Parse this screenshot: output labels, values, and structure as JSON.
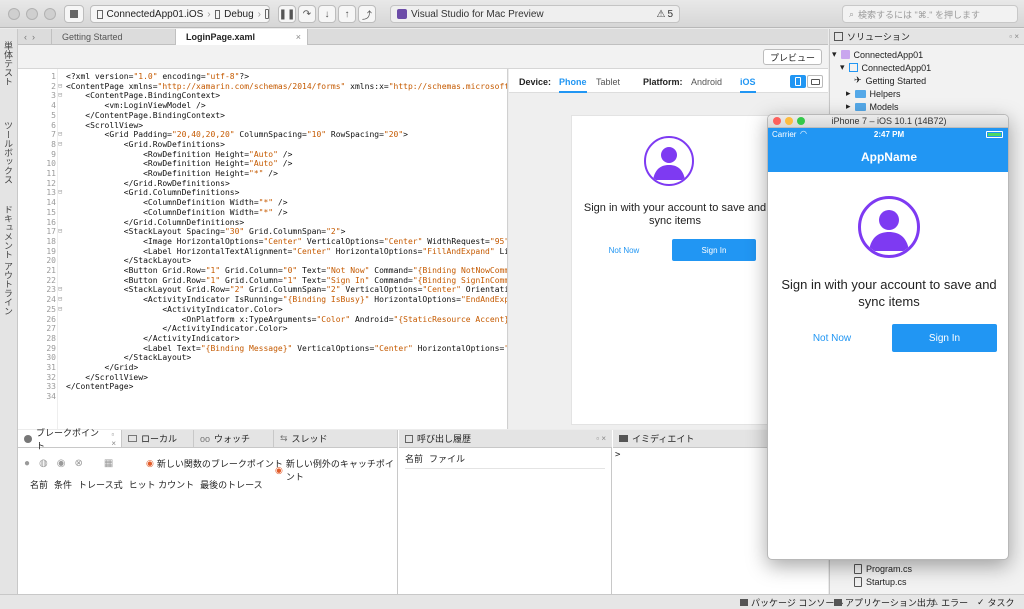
{
  "window": {
    "path_project": "ConnectedApp01.iOS",
    "path_config": "Debug",
    "status_text": "Visual Studio for Mac Preview",
    "warning_count": "5",
    "search_placeholder": "検索するには \"⌘.\" を押します"
  },
  "left_strip": {
    "items": [
      "単体テスト",
      "ツールボックス",
      "ドキュメント アウトライン"
    ]
  },
  "tabs": [
    {
      "label": "Getting Started"
    },
    {
      "label": "LoginPage.xaml"
    }
  ],
  "editor_toolbar": {
    "preview_button": "プレビュー"
  },
  "code": {
    "line_numbers": [
      "1",
      "2",
      "3",
      "4",
      "5",
      "6",
      "7",
      "8",
      "9",
      "10",
      "11",
      "12",
      "13",
      "14",
      "15",
      "16",
      "17",
      "18",
      "19",
      "20",
      "21",
      "22",
      "23",
      "24",
      "25",
      "26",
      "27",
      "28",
      "29",
      "30",
      "31",
      "32",
      "33",
      "34"
    ],
    "lines": [
      "<?xml version=\"1.0\" encoding=\"utf-8\"?>",
      "<ContentPage xmlns=\"http://xamarin.com/schemas/2014/forms\" xmlns:x=\"http://schemas.microsoft.",
      "    <ContentPage.BindingContext>",
      "        <vm:LoginViewModel />",
      "    </ContentPage.BindingContext>",
      "    <ScrollView>",
      "        <Grid Padding=\"20,40,20,20\" ColumnSpacing=\"10\" RowSpacing=\"20\">",
      "            <Grid.RowDefinitions>",
      "                <RowDefinition Height=\"Auto\" />",
      "                <RowDefinition Height=\"Auto\" />",
      "                <RowDefinition Height=\"*\" />",
      "            </Grid.RowDefinitions>",
      "            <Grid.ColumnDefinitions>",
      "                <ColumnDefinition Width=\"*\" />",
      "                <ColumnDefinition Width=\"*\" />",
      "            </Grid.ColumnDefinitions>",
      "            <StackLayout Spacing=\"30\" Grid.ColumnSpan=\"2\">",
      "                <Image HorizontalOptions=\"Center\" VerticalOptions=\"Center\" WidthRequest=\"95\"",
      "                <Label HorizontalTextAlignment=\"Center\" HorizontalOptions=\"FillAndExpand\" Lin",
      "            </StackLayout>",
      "            <Button Grid.Row=\"1\" Grid.Column=\"0\" Text=\"Not Now\" Command=\"{Binding NotNowComma",
      "            <Button Grid.Row=\"1\" Grid.Column=\"1\" Text=\"Sign In\" Command=\"{Binding SignInComma",
      "            <StackLayout Grid.Row=\"2\" Grid.ColumnSpan=\"2\" VerticalOptions=\"Center\" Orientatio",
      "                <ActivityIndicator IsRunning=\"{Binding IsBusy}\" HorizontalOptions=\"EndAndExpa",
      "                    <ActivityIndicator.Color>",
      "                        <OnPlatform x:TypeArguments=\"Color\" Android=\"{StaticResource Accent}\"",
      "                    </ActivityIndicator.Color>",
      "                </ActivityIndicator>",
      "                <Label Text=\"{Binding Message}\" VerticalOptions=\"Center\" HorizontalOptions=\"",
      "            </StackLayout>",
      "        </Grid>",
      "    </ScrollView>",
      "</ContentPage>",
      ""
    ]
  },
  "preview": {
    "device_label": "Device:",
    "device_options": [
      "Phone",
      "Tablet"
    ],
    "platform_label": "Platform:",
    "platform_options": [
      "Android",
      "iOS"
    ],
    "message": "Sign in with your account to save and sync items",
    "not_now": "Not Now",
    "sign_in": "Sign In"
  },
  "simulator": {
    "title": "iPhone 7 – iOS 10.1 (14B72)",
    "carrier": "Carrier",
    "time": "2:47 PM",
    "app_name": "AppName",
    "message": "Sign in with your account to save and sync items",
    "not_now": "Not Now",
    "sign_in": "Sign In"
  },
  "bottom": {
    "tabs": [
      {
        "label": "ブレークポイント"
      },
      {
        "label": "ローカル"
      },
      {
        "label": "ウォッチ"
      },
      {
        "label": "スレッド"
      }
    ],
    "new_function_breakpoint": "新しい関数のブレークポイント",
    "new_exception_catchpoint": "新しい例外のキャッチポイント",
    "bp_columns": [
      "名前",
      "条件",
      "トレース式",
      "ヒット カウント",
      "最後のトレース"
    ],
    "callstack_title": "呼び出し履歴",
    "callstack_columns": [
      "名前",
      "ファイル"
    ],
    "immediate_title": "イミディエイト",
    "immediate_prompt": ">"
  },
  "solution": {
    "title": "ソリューション",
    "items": [
      {
        "label": "ConnectedApp01"
      },
      {
        "label": "ConnectedApp01"
      },
      {
        "label": "Getting Started"
      },
      {
        "label": "Helpers"
      },
      {
        "label": "Models"
      }
    ],
    "bottom_items": [
      {
        "label": "Program.cs"
      },
      {
        "label": "Startup.cs"
      }
    ]
  },
  "statusbar": {
    "package_console": "パッケージ コンソール",
    "app_output": "アプリケーション出力",
    "errors": "エラー",
    "tasks": "タスク"
  },
  "colors": {
    "accent": "#2196f3",
    "avatar": "#7e3af2",
    "xml_string": "#c55a00",
    "xml_tag": "#111111"
  }
}
